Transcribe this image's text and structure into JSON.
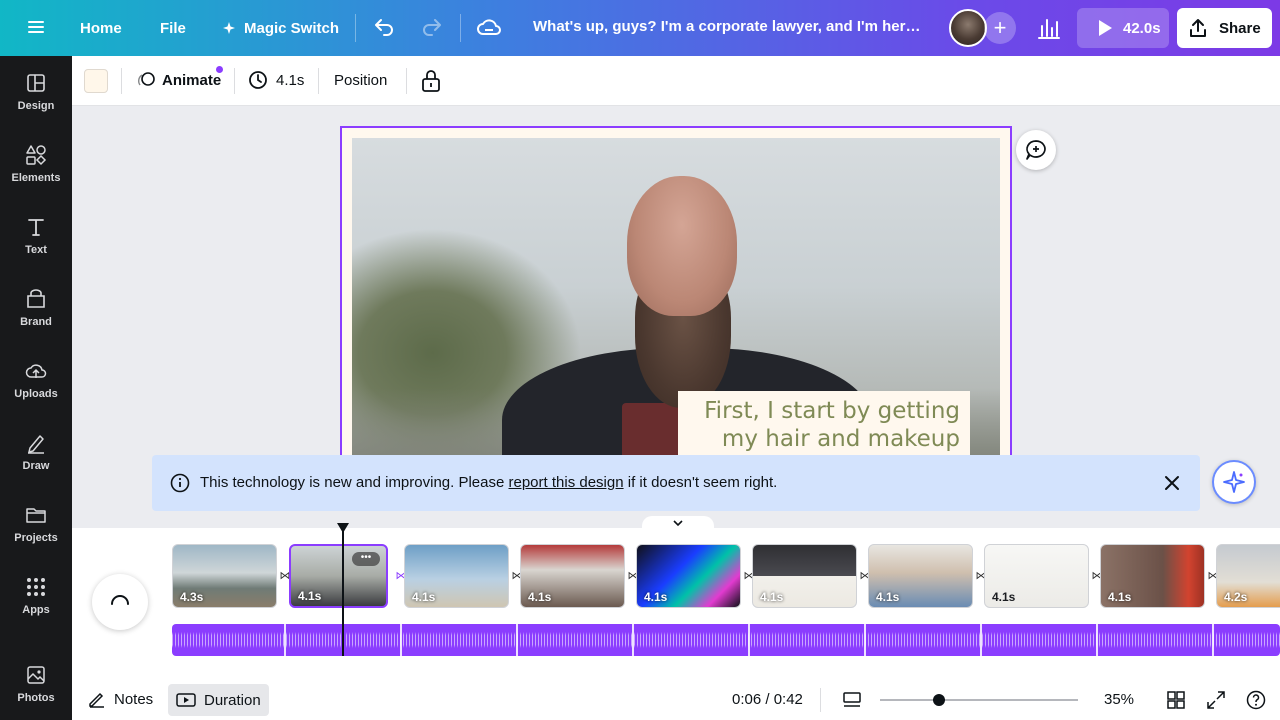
{
  "topbar": {
    "home": "Home",
    "file": "File",
    "magic_switch": "Magic Switch",
    "title": "What's up, guys? I'm a corporate lawyer, and I'm here to ...",
    "play_duration": "42.0s",
    "share": "Share"
  },
  "rail": [
    {
      "label": "Design",
      "icon": "design-icon"
    },
    {
      "label": "Elements",
      "icon": "elements-icon"
    },
    {
      "label": "Text",
      "icon": "text-icon"
    },
    {
      "label": "Brand",
      "icon": "brand-icon"
    },
    {
      "label": "Uploads",
      "icon": "uploads-icon"
    },
    {
      "label": "Draw",
      "icon": "draw-icon"
    },
    {
      "label": "Projects",
      "icon": "projects-icon"
    },
    {
      "label": "Apps",
      "icon": "apps-icon"
    },
    {
      "label": "Photos",
      "icon": "photos-icon"
    }
  ],
  "context_toolbar": {
    "animate": "Animate",
    "duration": "4.1s",
    "position": "Position",
    "swatch_color": "#fff7ea"
  },
  "canvas": {
    "caption": "First, I start by getting my hair and makeup done"
  },
  "banner": {
    "text_before": "This technology is new and improving. Please ",
    "link": "report this design",
    "text_after": " if it doesn't seem right."
  },
  "timeline": {
    "clips": [
      {
        "duration": "4.3s",
        "theme": "beach"
      },
      {
        "duration": "4.1s",
        "theme": "selected"
      },
      {
        "duration": "4.1s",
        "theme": "sky"
      },
      {
        "duration": "4.1s",
        "theme": "crowd"
      },
      {
        "duration": "4.1s",
        "theme": "neon"
      },
      {
        "duration": "4.1s",
        "theme": "frames"
      },
      {
        "duration": "4.1s",
        "theme": "kid"
      },
      {
        "duration": "4.1s",
        "theme": "doc"
      },
      {
        "duration": "4.1s",
        "theme": "palette"
      },
      {
        "duration": "4.2s",
        "theme": "bird"
      }
    ]
  },
  "footer": {
    "notes": "Notes",
    "duration": "Duration",
    "time": "0:06 / 0:42",
    "zoom": "35%",
    "zoom_fraction": 0.3
  },
  "colors": {
    "accent": "#8b3dff",
    "banner": "#d3e3fd",
    "rail": "#18191b"
  }
}
